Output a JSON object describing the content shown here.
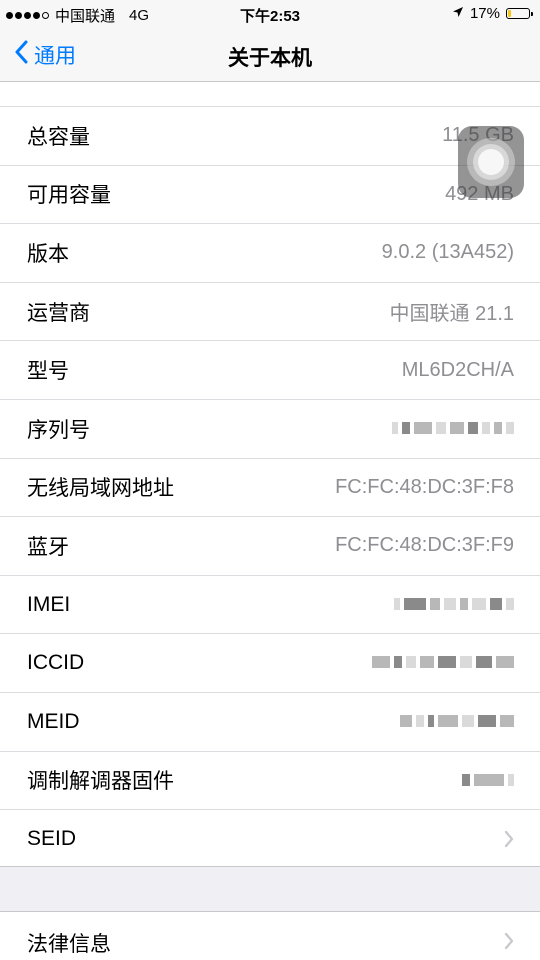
{
  "status": {
    "carrier": "中国联通",
    "network": "4G",
    "time": "下午2:53",
    "battery_pct": "17%",
    "battery_level": 0.17,
    "icons": [
      "signal-dots-icon",
      "location-arrow-icon",
      "battery-icon"
    ]
  },
  "nav": {
    "back_label": "通用",
    "title": "关于本机"
  },
  "rows": {
    "total_capacity": {
      "label": "总容量",
      "value": "11.5 GB"
    },
    "available_capacity": {
      "label": "可用容量",
      "value": "492 MB"
    },
    "version": {
      "label": "版本",
      "value": "9.0.2 (13A452)"
    },
    "carrier": {
      "label": "运营商",
      "value": "中国联通 21.1"
    },
    "model": {
      "label": "型号",
      "value": "ML6D2CH/A"
    },
    "serial": {
      "label": "序列号"
    },
    "wifi_address": {
      "label": "无线局域网地址",
      "value": "FC:FC:48:DC:3F:F8"
    },
    "bluetooth": {
      "label": "蓝牙",
      "value": "FC:FC:48:DC:3F:F9"
    },
    "imei": {
      "label": "IMEI"
    },
    "iccid": {
      "label": "ICCID"
    },
    "meid": {
      "label": "MEID"
    },
    "modem_firmware": {
      "label": "调制解调器固件"
    },
    "seid": {
      "label": "SEID"
    }
  },
  "section2": {
    "legal": {
      "label": "法律信息"
    }
  },
  "colors": {
    "accent": "#007aff",
    "secondary_text": "#8e8e93",
    "background": "#efeff4",
    "battery_fill": "#f5c518"
  }
}
